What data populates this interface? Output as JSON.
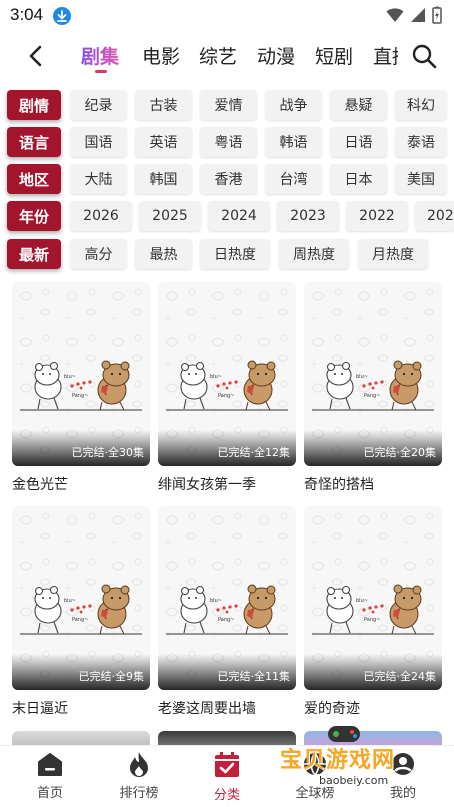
{
  "status_bar": {
    "time": "3:04"
  },
  "top_nav": {
    "tabs": [
      "剧集",
      "电影",
      "综艺",
      "动漫",
      "短剧",
      "直播"
    ],
    "active_tab": "剧集"
  },
  "filters": [
    {
      "label": "剧情",
      "options": [
        "纪录",
        "古装",
        "爱情",
        "战争",
        "悬疑",
        "科幻"
      ]
    },
    {
      "label": "语言",
      "options": [
        "国语",
        "英语",
        "粤语",
        "韩语",
        "日语",
        "泰语"
      ]
    },
    {
      "label": "地区",
      "options": [
        "大陆",
        "韩国",
        "香港",
        "台湾",
        "日本",
        "美国"
      ]
    },
    {
      "label": "年份",
      "options": [
        "2026",
        "2025",
        "2024",
        "2023",
        "2022",
        "2021"
      ]
    },
    {
      "label": "最新",
      "options": [
        "高分",
        "最热",
        "日热度",
        "周热度",
        "月热度"
      ]
    }
  ],
  "cards": [
    {
      "title": "金色光芒",
      "status": "已完结·全30集"
    },
    {
      "title": "绯闻女孩第一季",
      "status": "已完结·全12集"
    },
    {
      "title": "奇怪的搭档",
      "status": "已完结·全20集"
    },
    {
      "title": "末日逼近",
      "status": "已完结·全9集"
    },
    {
      "title": "老婆这周要出墙",
      "status": "已完结·全11集"
    },
    {
      "title": "爱的奇迹",
      "status": "已完结·全24集"
    }
  ],
  "bottom_nav": [
    {
      "label": "首页",
      "icon": "home-icon"
    },
    {
      "label": "排行榜",
      "icon": "flame-icon"
    },
    {
      "label": "分类",
      "icon": "calendar-check-icon",
      "active": true
    },
    {
      "label": "全球榜",
      "icon": "globe-icon"
    },
    {
      "label": "我的",
      "icon": "user-icon"
    }
  ],
  "watermark": {
    "text": "宝贝游戏网",
    "url": "baobeiy.com"
  },
  "colors": {
    "accent": "#a3152c",
    "tab_gradient_start": "#8a4fe0",
    "tab_gradient_end": "#e055b0",
    "active_nav": "#c21f3a"
  }
}
